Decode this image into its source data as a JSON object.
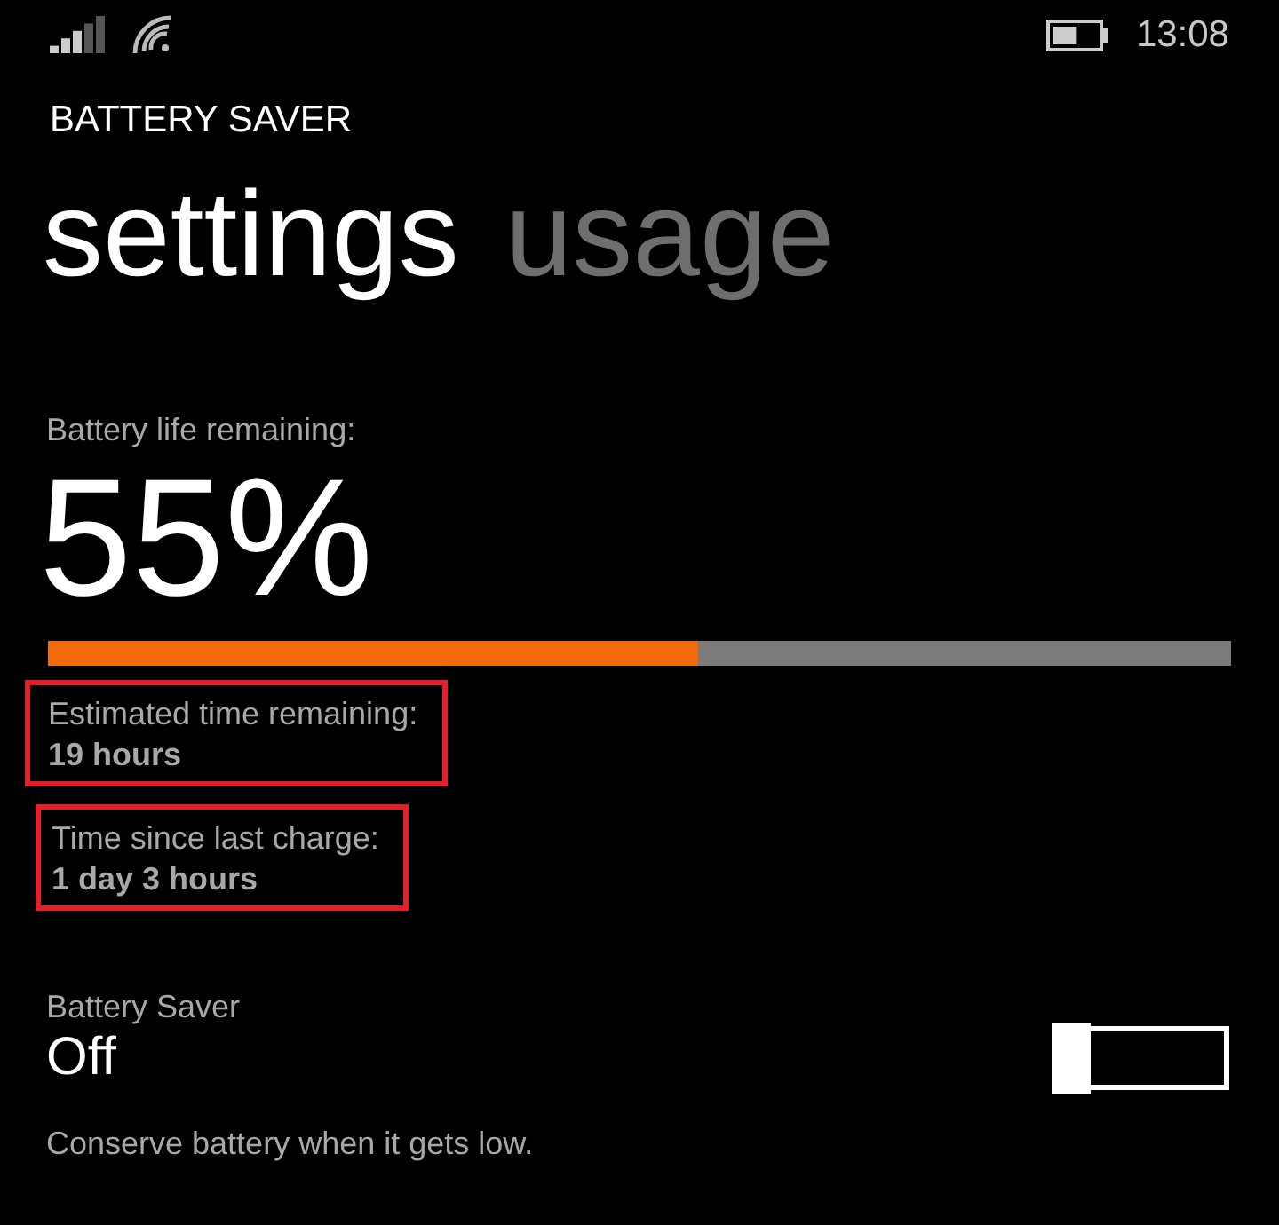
{
  "status_bar": {
    "time": "13:08"
  },
  "app_title": "BATTERY SAVER",
  "pivots": [
    {
      "label": "settings",
      "selected": true
    },
    {
      "label": "usage",
      "selected": false
    }
  ],
  "battery": {
    "label": "Battery life remaining:",
    "percent": "55%",
    "level": 0.55
  },
  "info": [
    {
      "label": "Estimated time remaining:",
      "value": "19 hours",
      "highlighted": true
    },
    {
      "label": "Time since last charge:",
      "value": "1 day 3 hours",
      "highlighted": true
    }
  ],
  "battery_saver": {
    "label": "Battery Saver",
    "state_text": "Off",
    "on": false,
    "description": "Conserve battery when it gets low."
  }
}
